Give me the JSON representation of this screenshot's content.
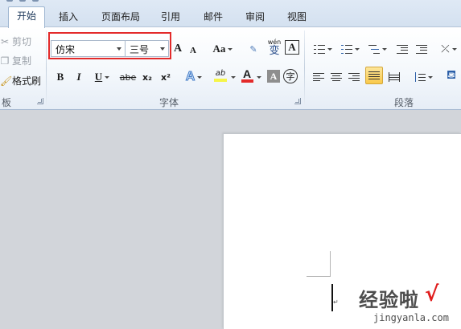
{
  "tabs": [
    "开始",
    "插入",
    "页面布局",
    "引用",
    "邮件",
    "审阅",
    "视图"
  ],
  "clipboard": {
    "cut_label": "剪切",
    "copy_label": "复制",
    "format_painter_label": "格式刷",
    "group_label": "板"
  },
  "font": {
    "font_name": "仿宋",
    "font_size": "三号",
    "grow_label": "A",
    "shrink_label": "A",
    "case_label": "Aa",
    "phonetic_label": "wén",
    "phonetic_char": "变",
    "border_label": "A",
    "bold_label": "B",
    "italic_label": "I",
    "underline_label": "U",
    "strike_label": "abe",
    "subscript_label": "x₂",
    "superscript_label": "x²",
    "effect_label": "A",
    "highlight_label": "ab",
    "color_label": "A",
    "shading_label": "A",
    "enclose_label": "字",
    "group_label": "字体"
  },
  "paragraph": {
    "group_label": "段落"
  },
  "colors": {
    "highlight": "#f5f54a",
    "font_color": "#e32a2a",
    "selection_box": "#e32a2a"
  },
  "watermark": {
    "text": "经验啦",
    "check": "√",
    "url": "jingyanla.com"
  }
}
